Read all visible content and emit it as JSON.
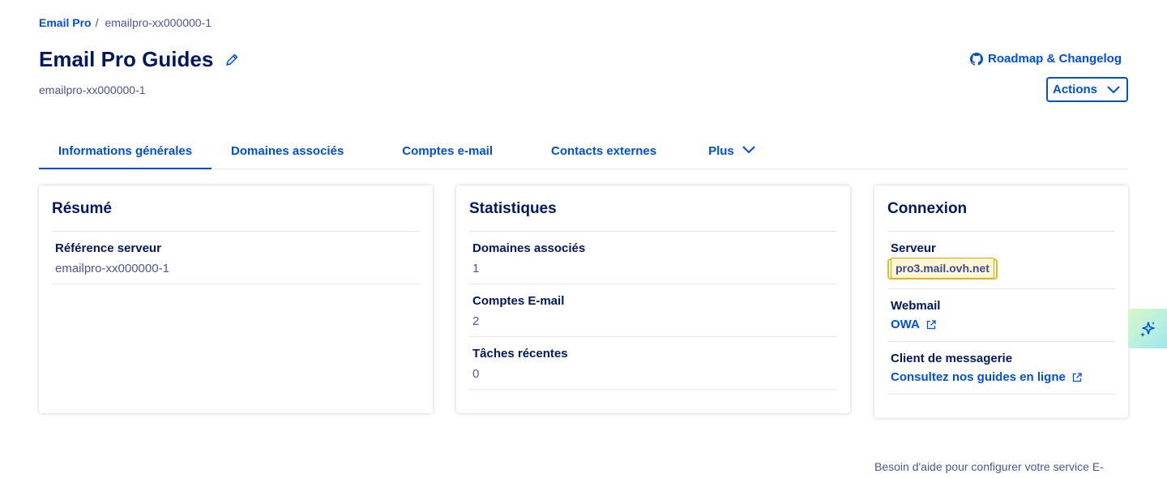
{
  "breadcrumb": {
    "root": "Email Pro",
    "separator": "/",
    "current": "emailpro-xx000000-1"
  },
  "header": {
    "title": "Email Pro Guides",
    "subtitle": "emailpro-xx000000-1",
    "roadmap_label": "Roadmap & Changelog",
    "actions_label": "Actions"
  },
  "tabs": [
    {
      "label": "Informations générales",
      "active": true
    },
    {
      "label": "Domaines associés"
    },
    {
      "label": "Comptes e-mail"
    },
    {
      "label": "Contacts externes"
    },
    {
      "label": "Plus"
    }
  ],
  "resume": {
    "title": "Résumé",
    "server_ref_label": "Référence serveur",
    "server_ref_value": "emailpro-xx000000-1"
  },
  "stats": {
    "title": "Statistiques",
    "rows": [
      {
        "label": "Domaines associés",
        "value": "1"
      },
      {
        "label": "Comptes E-mail",
        "value": "2"
      },
      {
        "label": "Tâches récentes",
        "value": "0"
      }
    ]
  },
  "connexion": {
    "title": "Connexion",
    "server_label": "Serveur",
    "server_value": "pro3.mail.ovh.net",
    "webmail_label": "Webmail",
    "webmail_link": "OWA",
    "client_label": "Client de messagerie",
    "client_link": "Consultez nos guides en ligne"
  },
  "help_text": "Besoin d'aide pour configurer votre service E-",
  "colors": {
    "primary": "#0050d7",
    "heading": "#00185e",
    "muted": "#4d5592",
    "highlight_border": "#f0b81f"
  },
  "icons": [
    "pencil-icon",
    "github-icon",
    "chevron-down-icon",
    "external-link-icon",
    "sparkle-icon"
  ]
}
